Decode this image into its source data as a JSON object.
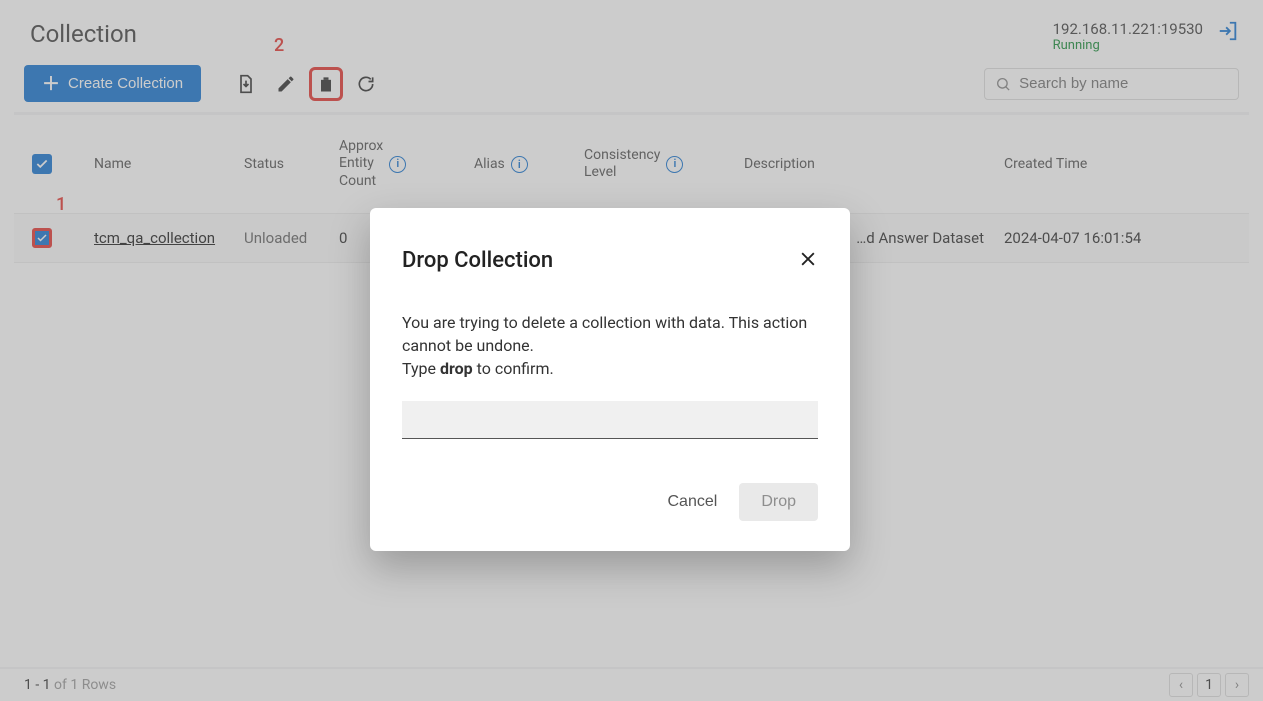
{
  "header": {
    "title": "Collection",
    "host": "192.168.11.221:19530",
    "status": "Running"
  },
  "toolbar": {
    "create_label": "Create Collection",
    "search_placeholder": "Search by name"
  },
  "columns": {
    "name": "Name",
    "status": "Status",
    "approx": "Approx\nEntity\nCount",
    "alias": "Alias",
    "consistency": "Consistency\nLevel",
    "description": "Description",
    "created": "Created Time"
  },
  "rows": [
    {
      "name": "tcm_qa_collection",
      "status": "Unloaded",
      "approx": "0",
      "alias": "",
      "consistency": "",
      "description": "…d Answer Dataset",
      "created": "2024-04-07 16:01:54"
    }
  ],
  "footer": {
    "range": "1 - 1",
    "of_label": " of 1 Rows",
    "page": "1"
  },
  "modal": {
    "title": "Drop Collection",
    "body_line1": "You are trying to delete a collection with data. This action cannot be undone.",
    "body_type": "Type ",
    "body_keyword": "drop",
    "body_confirm": " to confirm.",
    "cancel": "Cancel",
    "drop": "Drop"
  },
  "annotations": {
    "a1": "1",
    "a2": "2"
  }
}
